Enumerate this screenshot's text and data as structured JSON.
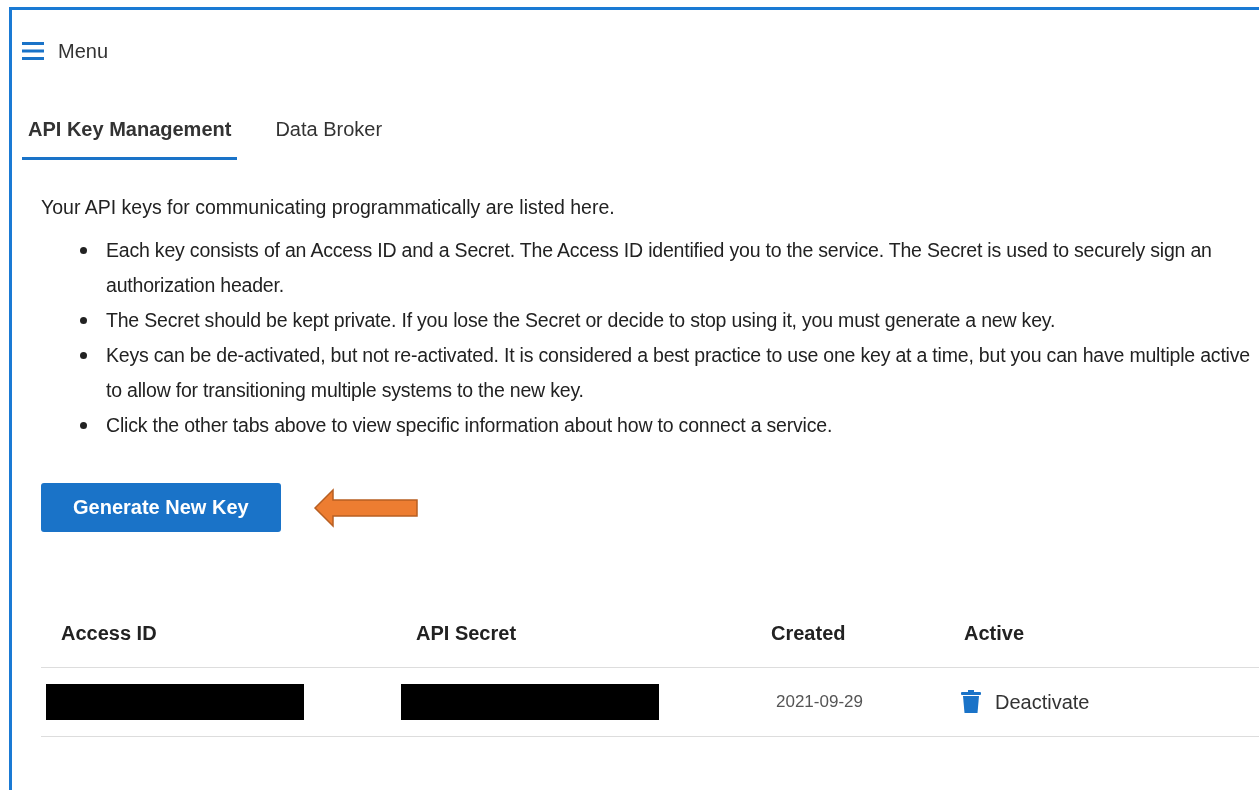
{
  "menu": {
    "label": "Menu"
  },
  "tabs": [
    {
      "label": "API Key Management",
      "selected": true
    },
    {
      "label": "Data Broker",
      "selected": false
    }
  ],
  "intro": "Your API keys for communicating programmatically are listed here.",
  "bullets": [
    "Each key consists of an Access ID and a Secret. The Access ID identified you to the service. The Secret is used to securely sign an authorization header.",
    "The Secret should be kept private. If you lose the Secret or decide to stop using it, you must generate a new key.",
    "Keys can be de-activated, but not re-activated. It is considered a best practice to use one key at a time, but you can have multiple active to allow for transitioning multiple systems to the new key.",
    "Click the other tabs above to view specific information about how to connect a service."
  ],
  "generate_button": "Generate New Key",
  "annotation": {
    "kind": "arrow",
    "color": "#ed7d31"
  },
  "table": {
    "columns": [
      "Access ID",
      "API Secret",
      "Created",
      "Active"
    ],
    "rows": [
      {
        "access_id_redacted": true,
        "secret_redacted": true,
        "created": "2021-09-29",
        "action": "Deactivate"
      }
    ]
  }
}
